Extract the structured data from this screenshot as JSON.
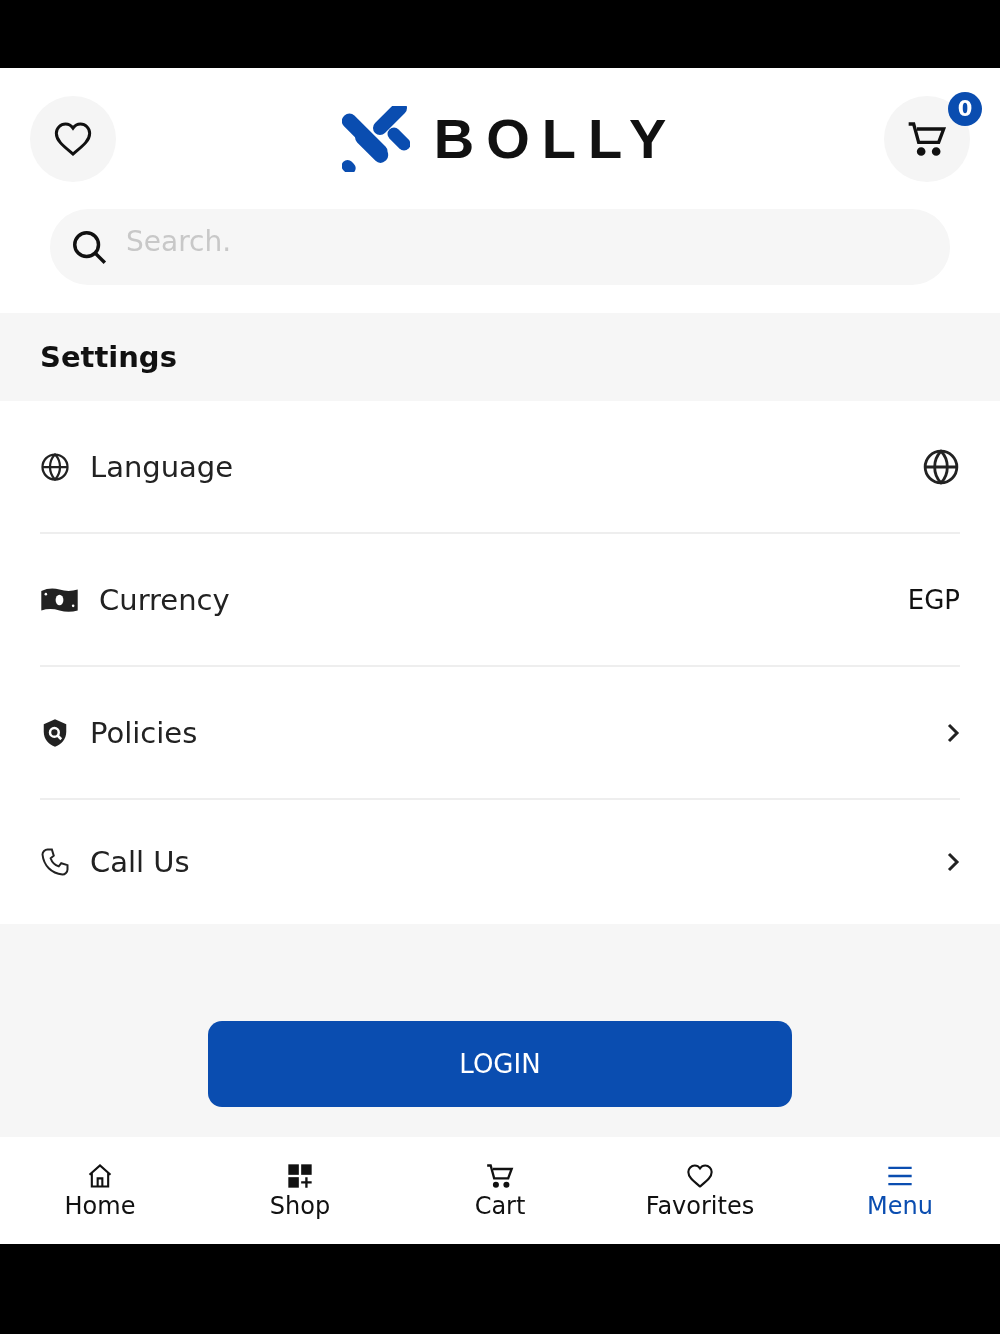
{
  "header": {
    "logo": "BOLLY",
    "cart_badge": "0"
  },
  "search": {
    "placeholder": "Search."
  },
  "section_title": "Settings",
  "settings": [
    {
      "label": "Language",
      "kind": "icon"
    },
    {
      "label": "Currency",
      "kind": "value",
      "value": "EGP"
    },
    {
      "label": "Policies",
      "kind": "chevron"
    },
    {
      "label": "Call Us",
      "kind": "chevron"
    }
  ],
  "login_button": "LOGIN",
  "bottom_nav": [
    {
      "label": "Home",
      "selected": false
    },
    {
      "label": "Shop",
      "selected": false
    },
    {
      "label": "Cart",
      "selected": false
    },
    {
      "label": "Favorites",
      "selected": false
    },
    {
      "label": "Menu",
      "selected": true
    }
  ]
}
